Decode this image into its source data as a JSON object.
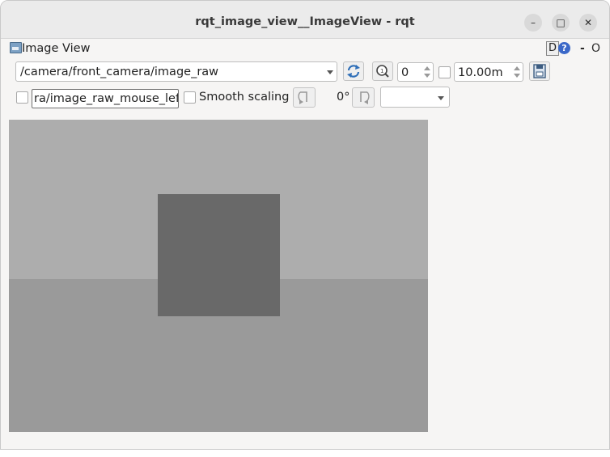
{
  "window": {
    "title": "rqt_image_view__ImageView - rqt"
  },
  "panel": {
    "title": "Image View",
    "d_button": "D",
    "help_button": "?",
    "minimize": "-",
    "close": "O"
  },
  "toolbar": {
    "topic": "/camera/front_camera/image_raw",
    "spin_value": "0",
    "rate_value": "10.00m",
    "mouse_topic": "ra/image_raw_mouse_left",
    "smooth_scaling_label": "Smooth scaling",
    "rotation": "0°",
    "rotation_select": ""
  },
  "image": {
    "background_upper": "#adadad",
    "background_lower": "#9a9a9a",
    "box": "#696969"
  }
}
